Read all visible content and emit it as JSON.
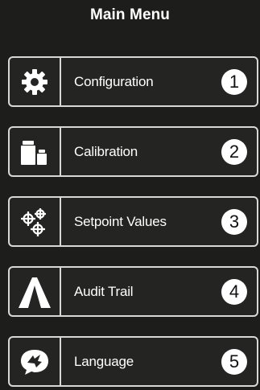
{
  "header": {
    "title": "Main Menu"
  },
  "menu": {
    "items": [
      {
        "label": "Configuration",
        "number": "1",
        "icon": "gear-icon"
      },
      {
        "label": "Calibration",
        "number": "2",
        "icon": "weights-icon"
      },
      {
        "label": "Setpoint Values",
        "number": "3",
        "icon": "crosshairs-icon"
      },
      {
        "label": "Audit Trail",
        "number": "4",
        "icon": "road-icon"
      },
      {
        "label": "Language",
        "number": "5",
        "icon": "speech-globe-icon"
      }
    ]
  },
  "colors": {
    "background": "#1d1d1c",
    "border": "#d8d8d6",
    "text": "#ffffff",
    "badge_bg": "#ffffff",
    "badge_text": "#111111"
  }
}
